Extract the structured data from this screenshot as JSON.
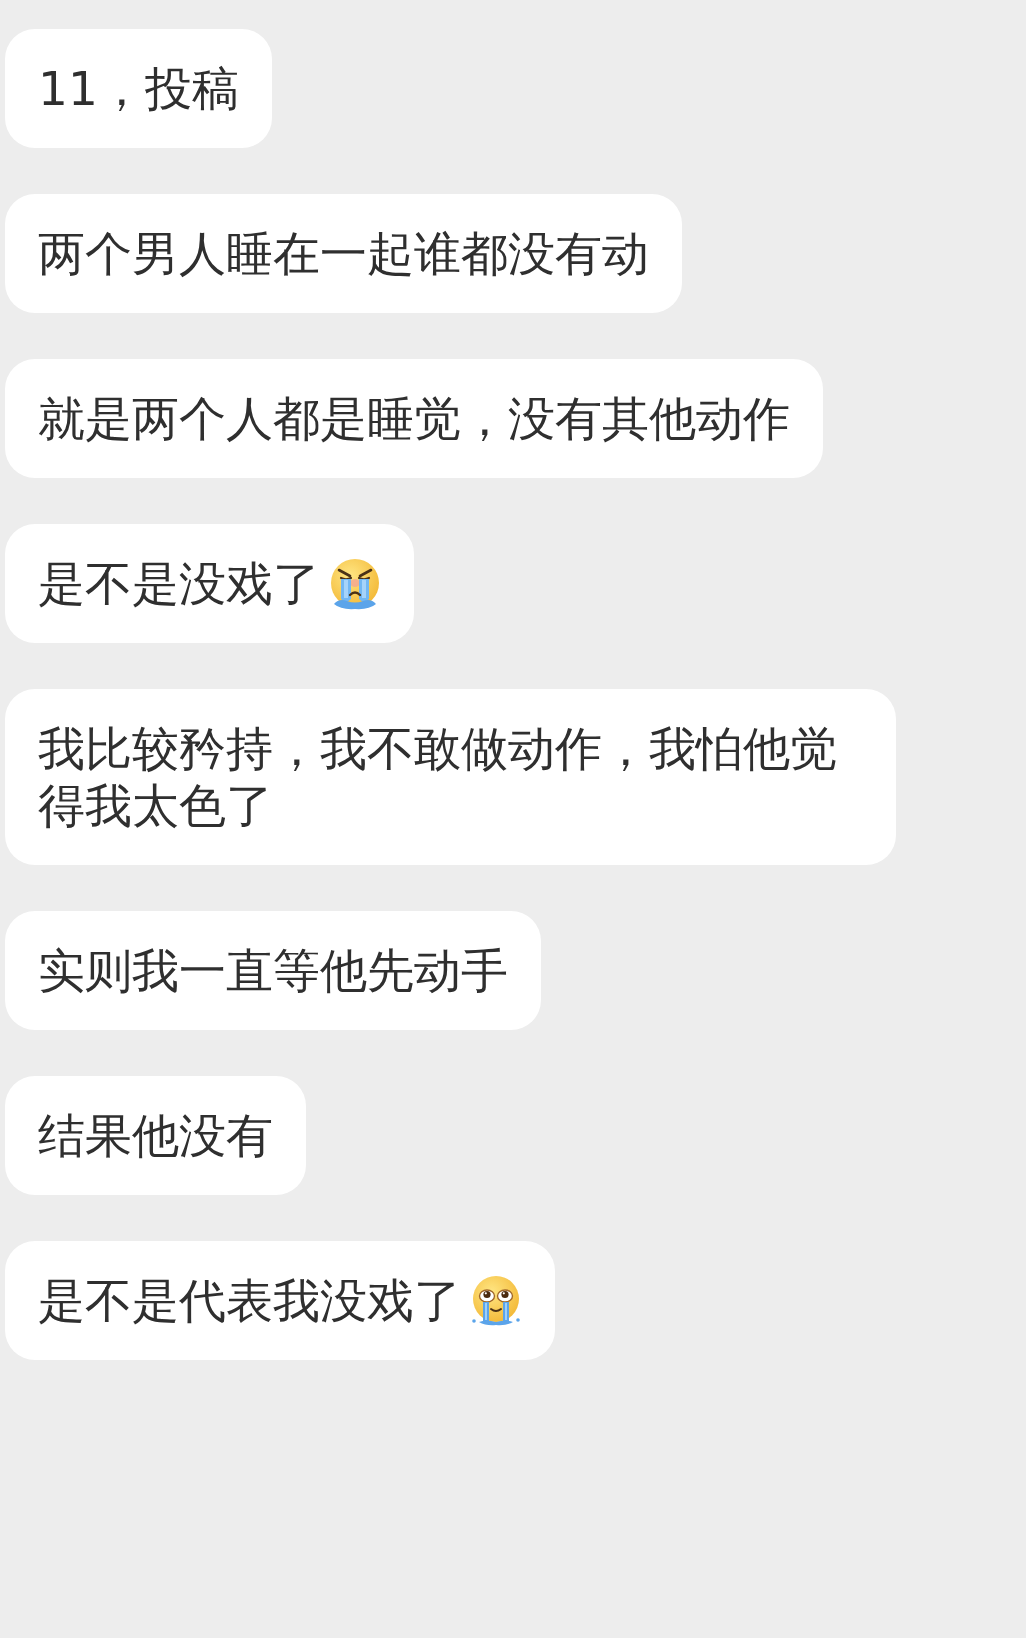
{
  "messages": [
    {
      "text": "11，投稿"
    },
    {
      "text": "两个男人睡在一起谁都没有动"
    },
    {
      "text": "就是两个人都是睡觉，没有其他动作"
    },
    {
      "text": "是不是没戏了",
      "emoji": {
        "kind": "wail"
      }
    },
    {
      "text": "我比较矜持，我不敢做动作，我怕他觉得我太色了"
    },
    {
      "text": "实则我一直等他先动手"
    },
    {
      "text": "结果他没有"
    },
    {
      "text": "是不是代表我没戏了",
      "emoji": {
        "kind": "teary"
      }
    }
  ]
}
